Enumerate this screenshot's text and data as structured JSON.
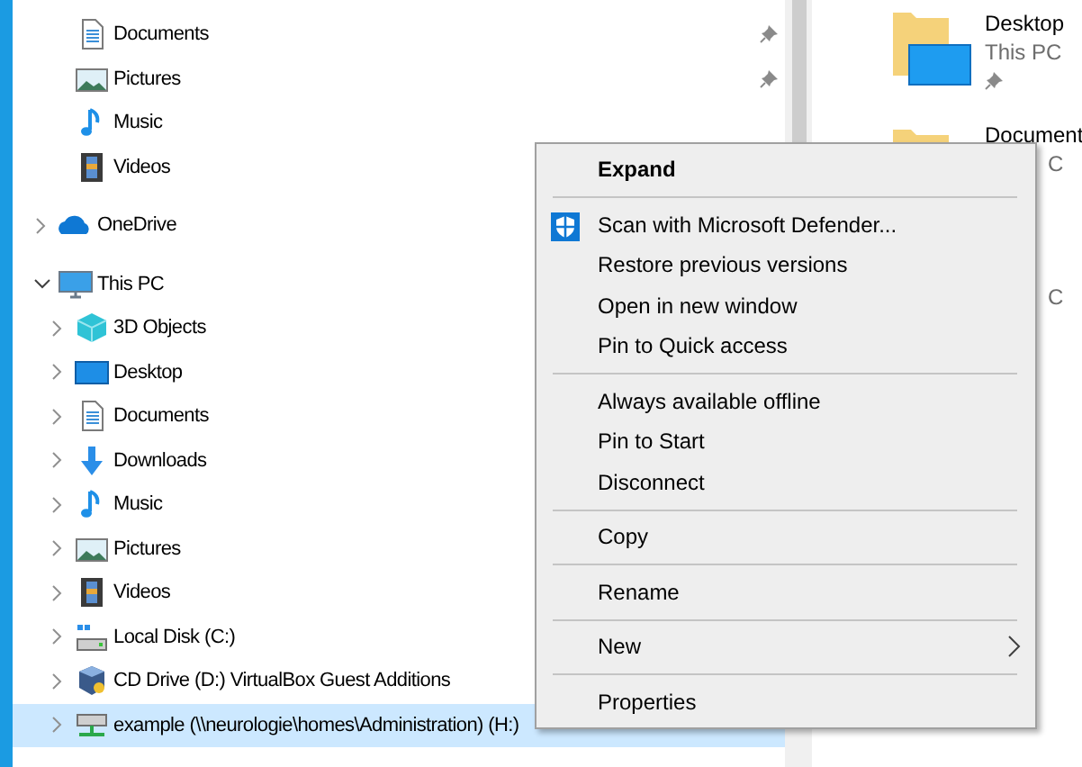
{
  "nav_pane": {
    "quick_access_items": [
      {
        "label": "Documents",
        "kind": "documents",
        "pinned": true,
        "selected": false
      },
      {
        "label": "Pictures",
        "kind": "pictures",
        "pinned": true,
        "selected": false
      },
      {
        "label": "Music",
        "kind": "music",
        "pinned": false,
        "selected": false
      },
      {
        "label": "Videos",
        "kind": "videos",
        "pinned": false,
        "selected": false
      }
    ],
    "tree": [
      {
        "label": "OneDrive",
        "kind": "onedrive",
        "expanded": false,
        "selected": false
      },
      {
        "label": "This PC",
        "kind": "pc",
        "expanded": true,
        "selected": false,
        "children": [
          {
            "label": "3D Objects",
            "kind": "objects3d",
            "expanded": false,
            "selected": false
          },
          {
            "label": "Desktop",
            "kind": "desktop",
            "expanded": false,
            "selected": false
          },
          {
            "label": "Documents",
            "kind": "documents",
            "expanded": false,
            "selected": false
          },
          {
            "label": "Downloads",
            "kind": "downloads",
            "expanded": false,
            "selected": false
          },
          {
            "label": "Music",
            "kind": "music",
            "expanded": false,
            "selected": false
          },
          {
            "label": "Pictures",
            "kind": "pictures",
            "expanded": false,
            "selected": false
          },
          {
            "label": "Videos",
            "kind": "videos",
            "expanded": false,
            "selected": false
          },
          {
            "label": "Local Disk (C:)",
            "kind": "disk",
            "expanded": false,
            "selected": false
          },
          {
            "label": "CD Drive (D:) VirtualBox Guest Additions",
            "kind": "cd",
            "expanded": false,
            "selected": false
          },
          {
            "label": "example (\\\\neurologie\\homes\\Administration) (H:)",
            "kind": "netdrive",
            "expanded": false,
            "selected": true
          }
        ]
      }
    ]
  },
  "content_pane": {
    "items": [
      {
        "name": "Desktop",
        "subtitle": "This PC",
        "kind": "desktop",
        "pinned": true
      },
      {
        "name": "Document",
        "subtitle": "C",
        "kind": "documents",
        "pinned": false
      },
      {
        "subtitle": "C",
        "kind": "none",
        "pinned": false
      }
    ]
  },
  "context_menu": {
    "groups": [
      [
        {
          "label": "Expand",
          "default": true,
          "kind": "plain",
          "submenu": false
        }
      ],
      [
        {
          "label": "Scan with Microsoft Defender...",
          "default": false,
          "kind": "shield",
          "submenu": false
        },
        {
          "label": "Restore previous versions",
          "default": false,
          "kind": "plain",
          "submenu": false
        },
        {
          "label": "Open in new window",
          "default": false,
          "kind": "plain",
          "submenu": false
        },
        {
          "label": "Pin to Quick access",
          "default": false,
          "kind": "plain",
          "submenu": false
        }
      ],
      [
        {
          "label": "Always available offline",
          "default": false,
          "kind": "plain",
          "submenu": false
        },
        {
          "label": "Pin to Start",
          "default": false,
          "kind": "plain",
          "submenu": false
        },
        {
          "label": "Disconnect",
          "default": false,
          "kind": "plain",
          "submenu": false
        }
      ],
      [
        {
          "label": "Copy",
          "default": false,
          "kind": "plain",
          "submenu": false
        }
      ],
      [
        {
          "label": "Rename",
          "default": false,
          "kind": "plain",
          "submenu": false
        }
      ],
      [
        {
          "label": "New",
          "default": false,
          "kind": "plain",
          "submenu": true
        }
      ],
      [
        {
          "label": "Properties",
          "default": false,
          "kind": "plain",
          "submenu": false
        }
      ]
    ]
  }
}
